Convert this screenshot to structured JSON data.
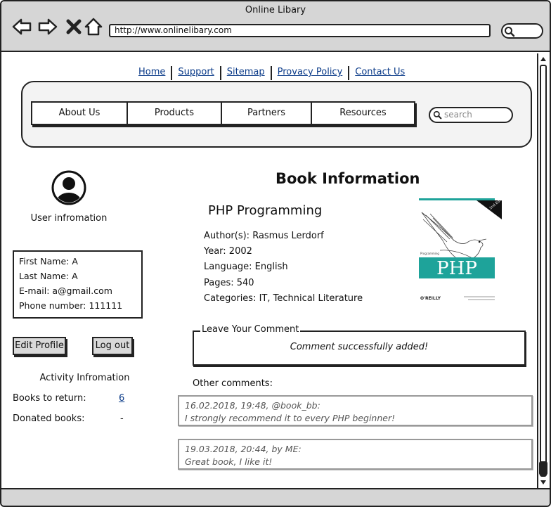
{
  "window": {
    "title": "Online Libary"
  },
  "browser": {
    "url": "http://www.onlinelibary.com"
  },
  "top_links": [
    "Home",
    "Support",
    "Sitemap",
    "Provacy Policy",
    "Contact Us"
  ],
  "menu": {
    "tabs": [
      "About Us",
      "Products",
      "Partners",
      "Resources"
    ],
    "search_placeholder": "search"
  },
  "user": {
    "section_title": "User infromation",
    "first_name": "First Name: A",
    "last_name": "Last Name: A",
    "email": "E-mail: a@gmail.com",
    "phone": "Phone number: 111111",
    "edit_button": "Edit Profile",
    "logout_button": "Log out"
  },
  "activity": {
    "title": "Activity Infromation",
    "books_to_return_label": "Books to return:",
    "books_to_return_value": "6",
    "donated_label": "Donated books:",
    "donated_value": "-"
  },
  "book": {
    "heading": "Book Information",
    "title": "PHP Programming",
    "authors": "Author(s): Rasmus Lerdorf",
    "year": "Year: 2002",
    "language": "Language: English",
    "pages": "Pages: 540",
    "categories": "Categories: IT, Technical Literature",
    "cover": {
      "title_text": "PHP",
      "banner_text": "Programming",
      "publisher": "O'REILLY",
      "edition": "2nd Edition",
      "accent_color": "#1ea39a"
    }
  },
  "comment_form": {
    "legend": "Leave Your Comment",
    "message": "Comment successfully added!"
  },
  "comments": {
    "title": "Other comments:",
    "items": [
      {
        "meta": "16.02.2018, 19:48, @book_bb:",
        "text": "I strongly recommend it to every PHP beginner!"
      },
      {
        "meta": "19.03.2018, 20:44, by ME:",
        "text": "Great book, I like it!"
      }
    ]
  }
}
